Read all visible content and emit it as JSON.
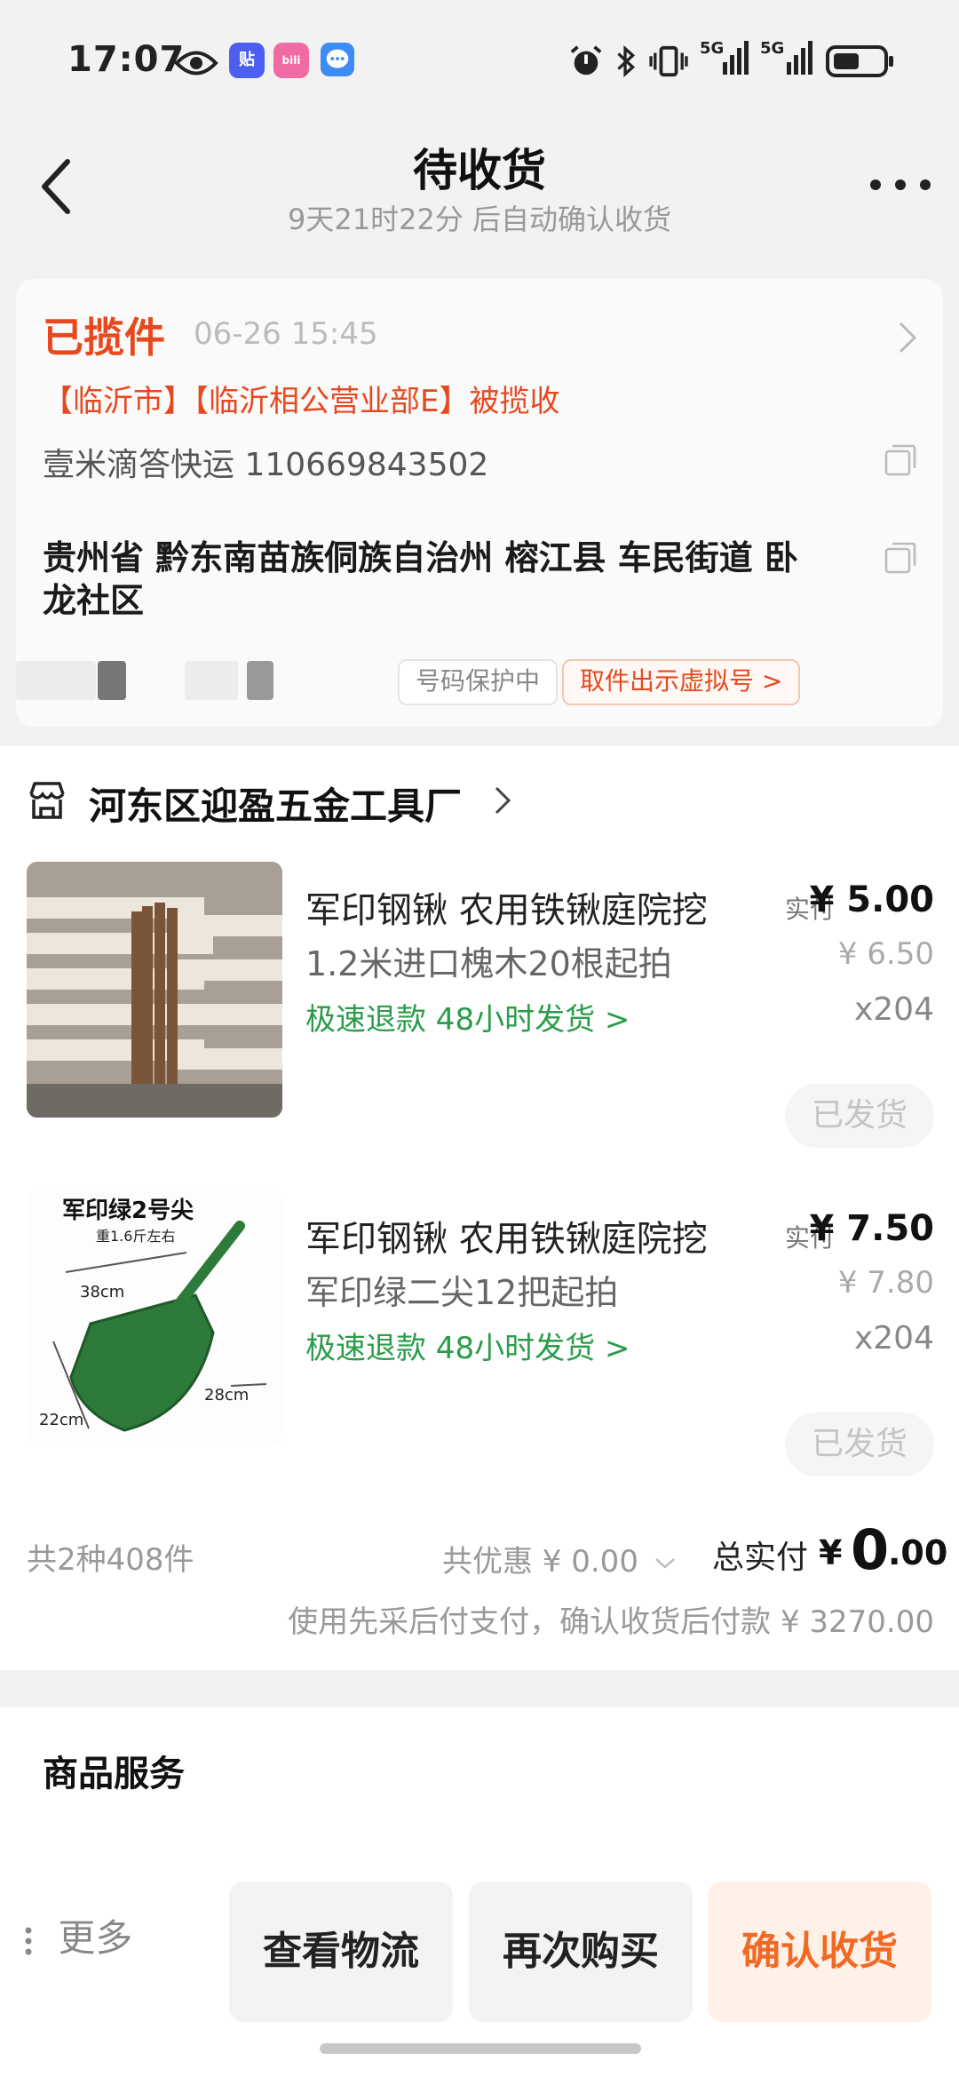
{
  "status_bar": {
    "time": "17:07",
    "app_badges": [
      "贴",
      "bili"
    ],
    "icons": [
      "eye-icon",
      "tieba-app-icon",
      "bilibili-app-icon",
      "message-app-icon",
      "alarm-icon",
      "bluetooth-icon",
      "vibrate-icon",
      "signal-5g-icon",
      "signal-5g-icon",
      "battery-icon"
    ],
    "signal_labels": [
      "5G",
      "5G"
    ]
  },
  "nav": {
    "title": "待收货",
    "subtitle": "9天21时22分 后自动确认收货"
  },
  "logistics": {
    "status": "已揽件",
    "time": "06-26 15:45",
    "location": "【临沂市】【临沂相公营业部E】被揽收",
    "carrier": "壹米滴答快运 110669843502",
    "address": "贵州省 黔东南苗族侗族自治州 榕江县 车民街道 卧龙社区",
    "privacy_tag": "号码保护中",
    "virtual_number_button": "取件出示虚拟号 >"
  },
  "shop": {
    "name": "河东区迎盈五金工具厂"
  },
  "items": [
    {
      "name": "军印钢锹 农用铁锹庭院挖",
      "spec": "1.2米进口槐木20根起拍",
      "speed": "极速退款  48小时发货 >",
      "paid_label": "实付",
      "price": "¥ 5.00",
      "original_price": "¥ 6.50",
      "qty": "x204",
      "status": "已发货"
    },
    {
      "name": "军印钢锹 农用铁锹庭院挖",
      "spec": "军印绿二尖12把起拍",
      "speed": "极速退款  48小时发货 >",
      "paid_label": "实付",
      "price": "¥ 7.50",
      "original_price": "¥ 7.80",
      "qty": "x204",
      "status": "已发货",
      "image_text": {
        "title": "军印绿2号尖",
        "weight": "重1.6斤左右",
        "dim1": "38cm",
        "dim2": "28cm",
        "dim3": "22cm"
      }
    }
  ],
  "summary": {
    "count": "共2种408件",
    "discount": "共优惠 ¥ 0.00",
    "total_label": "总实付",
    "total_symbol": "¥",
    "total_int": "0",
    "total_dec": ".00",
    "note": "使用先采后付支付，确认收货后付款 ¥ 3270.00"
  },
  "services": {
    "title": "商品服务"
  },
  "bottom": {
    "more": "更多",
    "btn_logistics": "查看物流",
    "btn_rebuy": "再次购买",
    "btn_confirm": "确认收货"
  },
  "colors": {
    "accent": "#e8481d",
    "green": "#2a9c4a",
    "confirm": "#f06a26"
  }
}
